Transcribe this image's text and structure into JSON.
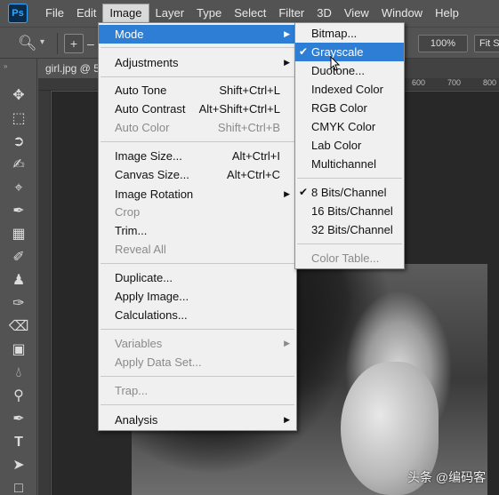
{
  "app": {
    "logo": "Ps"
  },
  "menubar": [
    "File",
    "Edit",
    "Image",
    "Layer",
    "Type",
    "Select",
    "Filter",
    "3D",
    "View",
    "Window",
    "Help"
  ],
  "options": {
    "zoom_percent": "100%",
    "fit_label": "Fit Sc"
  },
  "document": {
    "tab_title": "girl.jpg @ 5"
  },
  "ruler": {
    "labels": [
      "600",
      "700",
      "800"
    ]
  },
  "image_menu": {
    "mode": "Mode",
    "adjustments": "Adjustments",
    "auto_tone": "Auto Tone",
    "auto_tone_sc": "Shift+Ctrl+L",
    "auto_contrast": "Auto Contrast",
    "auto_contrast_sc": "Alt+Shift+Ctrl+L",
    "auto_color": "Auto Color",
    "auto_color_sc": "Shift+Ctrl+B",
    "image_size": "Image Size...",
    "image_size_sc": "Alt+Ctrl+I",
    "canvas_size": "Canvas Size...",
    "canvas_size_sc": "Alt+Ctrl+C",
    "image_rotation": "Image Rotation",
    "crop": "Crop",
    "trim": "Trim...",
    "reveal_all": "Reveal All",
    "duplicate": "Duplicate...",
    "apply_image": "Apply Image...",
    "calculations": "Calculations...",
    "variables": "Variables",
    "apply_data_set": "Apply Data Set...",
    "trap": "Trap...",
    "analysis": "Analysis"
  },
  "mode_menu": {
    "bitmap": "Bitmap...",
    "grayscale": "Grayscale",
    "duotone": "Duotone...",
    "indexed_color": "Indexed Color",
    "rgb_color": "RGB Color",
    "cmyk_color": "CMYK Color",
    "lab_color": "Lab Color",
    "multichannel": "Multichannel",
    "bits8": "8 Bits/Channel",
    "bits16": "16 Bits/Channel",
    "bits32": "32 Bits/Channel",
    "color_table": "Color Table..."
  },
  "watermark": "头条 @编码客",
  "colors": {
    "highlight": "#2e7ed6",
    "menu_bg": "#f0f0f0",
    "chrome": "#535353"
  }
}
